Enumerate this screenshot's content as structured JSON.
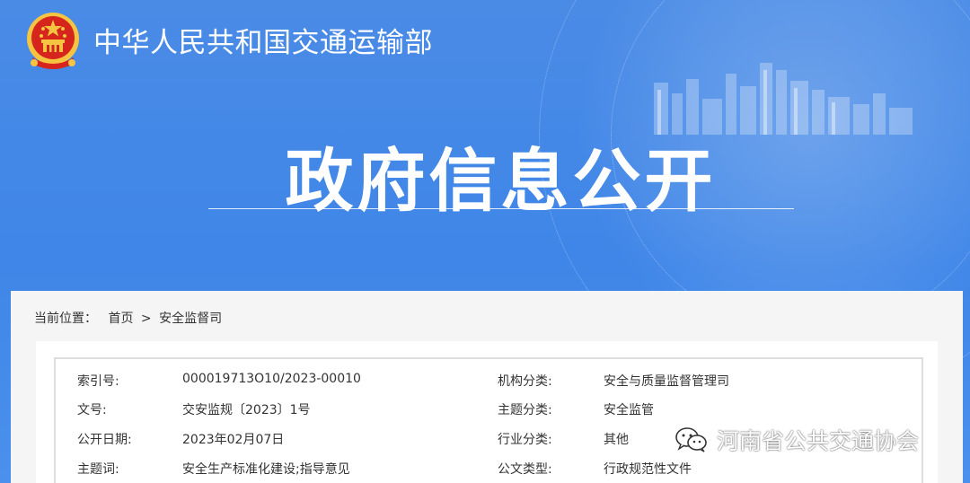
{
  "header": {
    "emblem_icon": "national-emblem-icon",
    "ministry_name": "中华人民共和国交通运输部",
    "banner_title": "政府信息公开"
  },
  "breadcrumb": {
    "label": "当前位置：",
    "home": "首页",
    "separator": ">",
    "current": "安全监督司"
  },
  "info_table": {
    "rows": [
      {
        "k1": "索引号:",
        "v1": "000019713O10/2023-00010",
        "k2": "机构分类:",
        "v2": "安全与质量监督管理司"
      },
      {
        "k1": "文号:",
        "v1": "交安监规〔2023〕1号",
        "k2": "主题分类:",
        "v2": "安全监管"
      },
      {
        "k1": "公开日期:",
        "v1": "2023年02月07日",
        "k2": "行业分类:",
        "v2": "其他"
      },
      {
        "k1": "主题词:",
        "v1": "安全生产标准化建设;指导意见",
        "k2": "公文类型:",
        "v2": "行政规范性文件"
      }
    ]
  },
  "watermark": {
    "icon": "wechat-icon",
    "text": "河南省公共交通协会"
  },
  "colors": {
    "banner_blue": "#4a8be6",
    "text_dark": "#333333",
    "emblem_red": "#d6251c",
    "emblem_gold": "#f5c542"
  }
}
